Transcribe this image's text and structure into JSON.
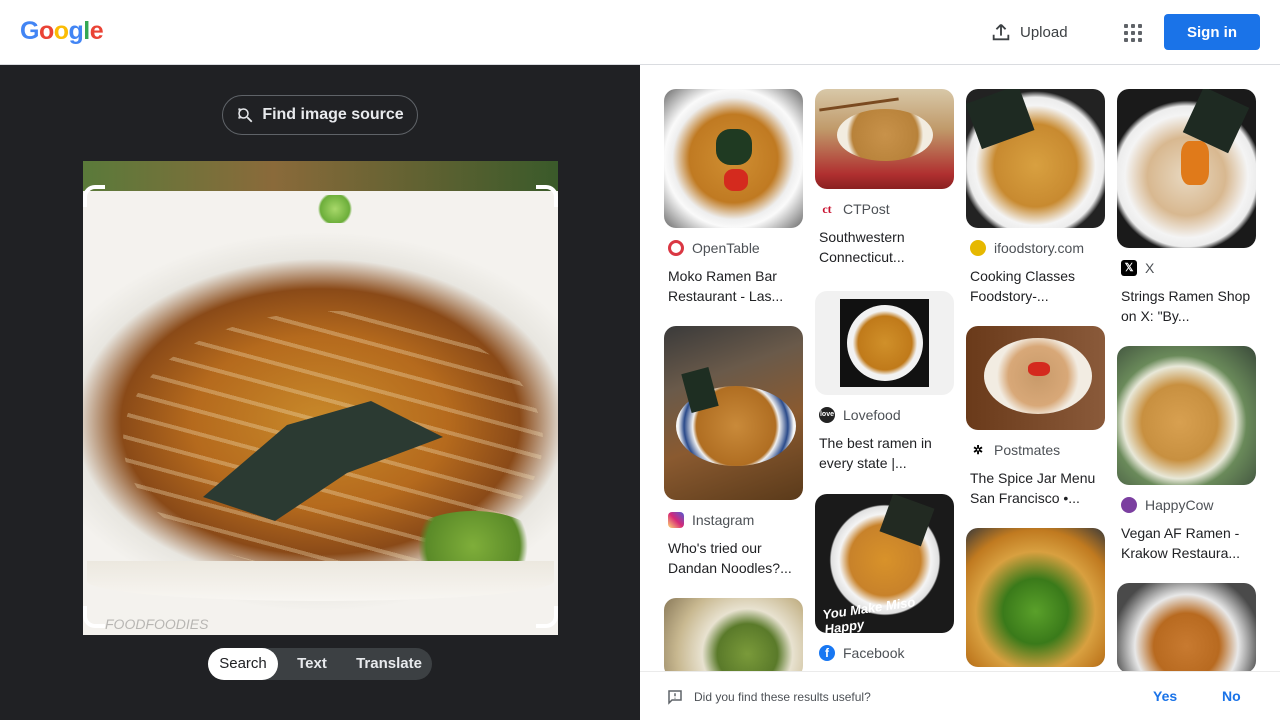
{
  "header": {
    "logo_letters": [
      "G",
      "o",
      "o",
      "g",
      "l",
      "e"
    ],
    "logo_colors": [
      "#4285f4",
      "#ea4335",
      "#fbbc05",
      "#4285f4",
      "#34a853",
      "#ea4335"
    ],
    "upload_label": "Upload",
    "apps_icon": "apps-grid-icon",
    "signin_label": "Sign in"
  },
  "lens": {
    "find_source_label": "Find image source",
    "photo_watermark": "FOODFOODIES",
    "modes": [
      {
        "label": "Search",
        "active": true
      },
      {
        "label": "Text",
        "active": false
      },
      {
        "label": "Translate",
        "active": false
      }
    ]
  },
  "results": [
    {
      "source": "OpenTable",
      "title": "Moko Ramen Bar Restaurant - Las...",
      "icon_color": "#da3743"
    },
    {
      "source": "Instagram",
      "title": "Who's tried our Dandan Noodles?...",
      "icon_color": "#d62976"
    },
    {
      "source": "CTPost",
      "title": "Southwestern Connecticut...",
      "icon_color": "#c8102e"
    },
    {
      "source": "Lovefood",
      "title": "The best ramen in every state |...",
      "icon_color": "#222222"
    },
    {
      "source": "Facebook",
      "title": "",
      "icon_color": "#1877f2"
    },
    {
      "source": "ifoodstory.com",
      "title": "Cooking Classes Foodstory-...",
      "icon_color": "#e6b800"
    },
    {
      "source": "Postmates",
      "title": "The Spice Jar Menu San Francisco •...",
      "icon_color": "#000000"
    },
    {
      "source": "X",
      "title": "Strings Ramen Shop on X: \"By...",
      "icon_color": "#000000"
    },
    {
      "source": "HappyCow",
      "title": "Vegan AF Ramen - Krakow Restaura...",
      "icon_color": "#7b3fa0"
    }
  ],
  "image_text": {
    "miso_caption": "You Make Miso Happy"
  },
  "feedback": {
    "question": "Did you find these results useful?",
    "yes": "Yes",
    "no": "No"
  }
}
